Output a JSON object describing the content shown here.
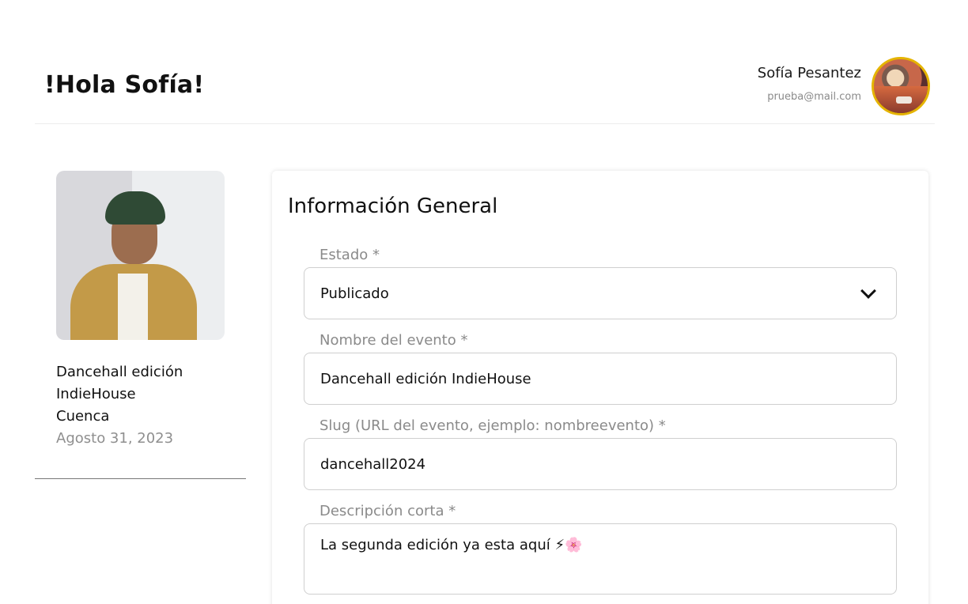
{
  "header": {
    "greeting": "!Hola Sofía!",
    "user_name": "Sofía Pesantez",
    "user_email": "prueba@mail.com"
  },
  "event": {
    "title_line1": "Dancehall edición",
    "title_line2": "IndieHouse",
    "city": "Cuenca",
    "date": "Agosto 31, 2023"
  },
  "form": {
    "title": "Información General",
    "estado_label": "Estado *",
    "estado_value": "Publicado",
    "nombre_label": "Nombre del evento *",
    "nombre_value": "Dancehall edición IndieHouse",
    "slug_label": "Slug (URL del evento, ejemplo: nombreevento) *",
    "slug_value": "dancehall2024",
    "descripcion_label": "Descripción corta *",
    "descripcion_value": "La segunda edición ya esta aquí ⚡🌸"
  },
  "colors": {
    "avatar_border": "#e5b400",
    "muted_text": "#8a8a8a",
    "border": "#cfcfcf"
  },
  "icons": {
    "select_arrow": "chevron-down-icon"
  }
}
